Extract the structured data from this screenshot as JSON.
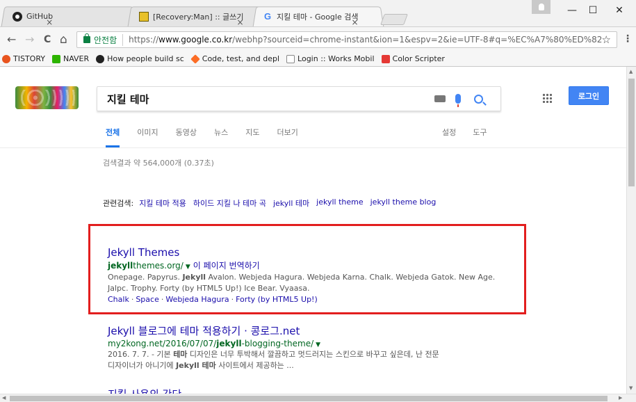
{
  "tabs": [
    {
      "title": "GitHub",
      "icon": "github-icon"
    },
    {
      "title": "[Recovery:Man] :: 글쓰기",
      "icon": "recovery-man-icon"
    },
    {
      "title": "지킬 테마 - Google 검색",
      "icon": "google-icon"
    }
  ],
  "tab_close_glyph": "×",
  "window": {
    "minimize": "—",
    "maximize": "☐",
    "close": "✕"
  },
  "nav": {
    "back": "←",
    "forward": "→",
    "reload": "C",
    "home": "⌂"
  },
  "address": {
    "secure_label": "안전함",
    "url_scheme": "https://",
    "url_host": "www.google.co.kr",
    "url_rest": "/webhp?sourceid=chrome-instant&ion=1&espv=2&ie=UTF-8#q=%EC%A7%80%ED%82%"
  },
  "bookmarks": [
    {
      "label": "TISTORY",
      "color": "#e8541e"
    },
    {
      "label": "NAVER",
      "color": "#2db400"
    },
    {
      "label": "How people build sc",
      "color": "#222222"
    },
    {
      "label": "Code, test, and depl",
      "color": "#fc6d26"
    },
    {
      "label": "Login :: Works Mobil",
      "color": "#ffffff"
    },
    {
      "label": "Color Scripter",
      "color": "#e53935"
    }
  ],
  "search": {
    "query": "지킬 테마",
    "login_label": "로그인"
  },
  "google_tabs": [
    "전체",
    "이미지",
    "동영상",
    "뉴스",
    "지도",
    "더보기"
  ],
  "google_tools": [
    "설정",
    "도구"
  ],
  "result_stats": "검색결과 약 564,000개 (0.37초)",
  "related": {
    "label": "관련검색:",
    "links": [
      "지킬 테마 적용",
      "하이드 지킬 나 테마 곡",
      "jekyll 테마",
      "jekyll theme",
      "jekyll theme blog"
    ]
  },
  "results": [
    {
      "title": "Jekyll Themes",
      "url_bold": "jekyll",
      "url_rest": "themes.org/",
      "translate": "이 페이지 번역하기",
      "snippet_line1_pre": "Onepage. Papyrus. ",
      "snippet_line1_bold": "Jekyll",
      "snippet_line1_post": " Avalon. Webjeda Hagura. Webjeda Karna. Chalk. Webjeda Gatok. New Age.",
      "snippet_line2": "Jalpc. Trophy. Forty (by HTML5 Up!) Ice Bear. Vyaasa.",
      "sitelinks": [
        "Chalk",
        "Space",
        "Webjeda Hagura",
        "Forty (by HTML5 Up!)"
      ]
    },
    {
      "title": "Jekyll 블로그에 테마 적용하기 · 콩로그.net",
      "url_pre": "my2kong.net/2016/07/07/",
      "url_bold": "jekyll",
      "url_post": "-blogging-theme/",
      "snippet_line1_pre": "2016. 7. 7. - 기본 ",
      "snippet_line1_bold": "테마",
      "snippet_line1_post": " 디자인은 너무 투박해서 깔끔하고 멋드러지는 스킨으로 바꾸고 싶은데, 난 전문",
      "snippet_line2_pre": "디자이너가 아니기에 ",
      "snippet_line2_bold": "Jekyll 테마",
      "snippet_line2_post": " 사이트에서 제공하는 ..."
    },
    {
      "title": "지킬 사용의 간단"
    }
  ],
  "colors": {
    "highlight_box": "#e21e1e",
    "link": "#1a0dab",
    "url": "#006621",
    "accent": "#4285f4"
  }
}
